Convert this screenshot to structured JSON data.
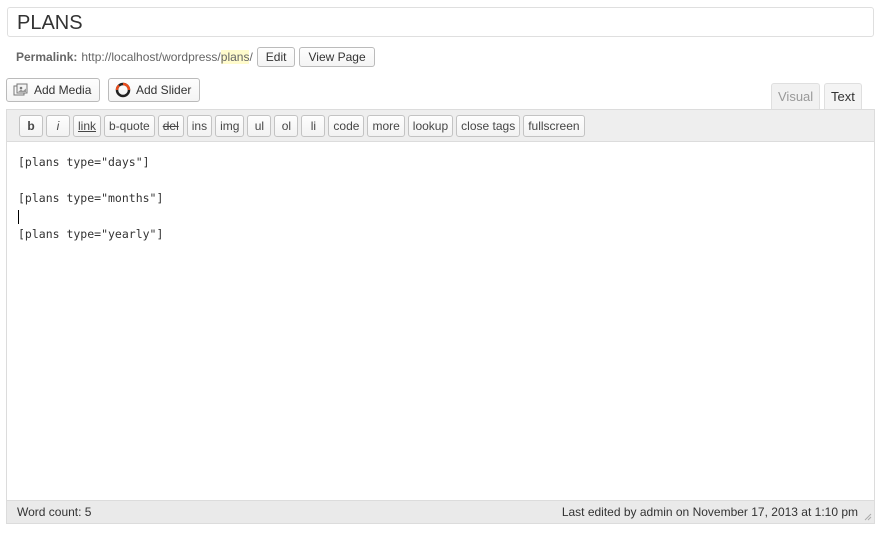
{
  "title": {
    "value": "PLANS"
  },
  "permalink": {
    "label": "Permalink:",
    "url_base": "http://localhost/wordpress/",
    "slug": "plans",
    "trailing": "/",
    "edit_label": "Edit",
    "view_label": "View Page"
  },
  "media": {
    "add_media_label": "Add Media",
    "add_slider_label": "Add Slider"
  },
  "tabs": {
    "visual": "Visual",
    "text": "Text",
    "active": "Text"
  },
  "quicktags": [
    {
      "label": "b"
    },
    {
      "label": "i"
    },
    {
      "label": "link"
    },
    {
      "label": "b-quote"
    },
    {
      "label": "del"
    },
    {
      "label": "ins"
    },
    {
      "label": "img"
    },
    {
      "label": "ul"
    },
    {
      "label": "ol"
    },
    {
      "label": "li"
    },
    {
      "label": "code"
    },
    {
      "label": "more"
    },
    {
      "label": "lookup"
    },
    {
      "label": "close tags"
    },
    {
      "label": "fullscreen"
    }
  ],
  "content": {
    "lines": [
      "[plans type=\"days\"]",
      "",
      "[plans type=\"months\"]",
      "",
      "[plans type=\"yearly\"]"
    ]
  },
  "status": {
    "word_count": "Word count: 5",
    "last_edited": "Last edited by admin on November 17, 2013 at 1:10 pm"
  },
  "colors": {
    "slug_highlight": "#fffbcc",
    "toolbar_bg": "#eeeeee",
    "statusbar_bg": "#eaeaea"
  }
}
